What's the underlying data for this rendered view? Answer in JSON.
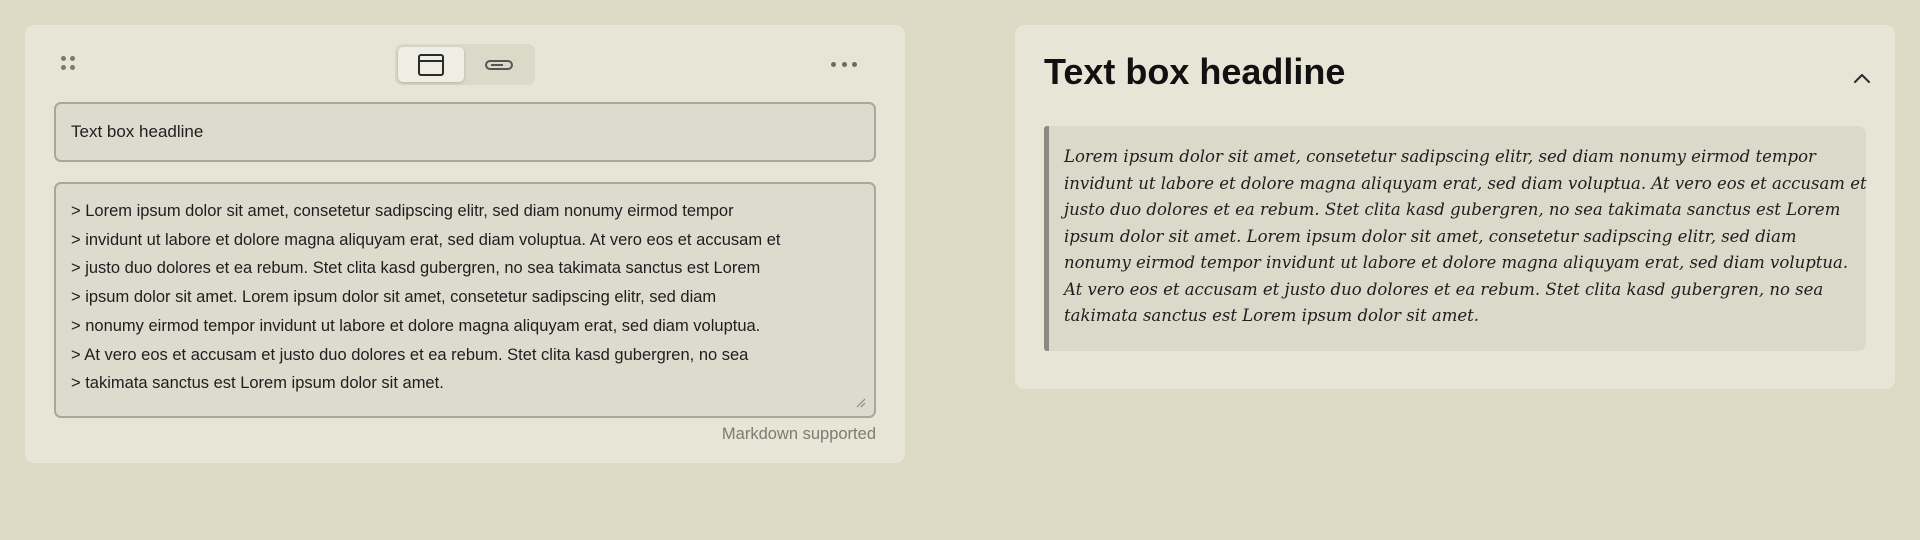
{
  "editor": {
    "view_modes": [
      {
        "name": "card-view",
        "icon": "window-icon",
        "active": true
      },
      {
        "name": "inline-view",
        "icon": "bar-icon",
        "active": false
      }
    ],
    "headline_value": "Text box headline",
    "body_lines": [
      "> Lorem ipsum dolor sit amet, consetetur sadipscing elitr, sed diam nonumy eirmod tempor",
      "> invidunt ut labore et dolore magna aliquyam erat, sed diam voluptua. At vero eos et accusam et",
      "> justo duo dolores et ea rebum. Stet clita kasd gubergren, no sea takimata sanctus est Lorem",
      "> ipsum dolor sit amet. Lorem ipsum dolor sit amet, consetetur sadipscing elitr, sed diam",
      "> nonumy eirmod tempor invidunt ut labore et dolore magna aliquyam erat, sed diam voluptua.",
      "> At vero eos et accusam et justo duo dolores et ea rebum. Stet clita kasd gubergren, no sea",
      "> takimata sanctus est Lorem ipsum dolor sit amet."
    ],
    "hint": "Markdown supported"
  },
  "preview": {
    "title": "Text box headline",
    "quote_lines": [
      "Lorem ipsum dolor sit amet, consetetur sadipscing elitr, sed diam nonumy eirmod tempor",
      "invidunt ut labore et dolore magna aliquyam erat, sed diam voluptua. At vero eos et accusam et",
      "justo duo dolores et ea rebum. Stet clita kasd gubergren, no sea takimata sanctus est Lorem",
      "ipsum dolor sit amet. Lorem ipsum dolor sit amet, consetetur sadipscing elitr, sed diam",
      "nonumy eirmod tempor invidunt ut labore et dolore magna aliquyam erat, sed diam voluptua.",
      "At vero eos et accusam et justo duo dolores et ea rebum. Stet clita kasd gubergren, no sea",
      "takimata sanctus est Lorem ipsum dolor sit amet."
    ]
  },
  "colors": {
    "page_background": "#dcdac5",
    "card_background": "#e7e5d6",
    "field_background": "#dcdbcd",
    "quote_border": "#8b8a80"
  }
}
